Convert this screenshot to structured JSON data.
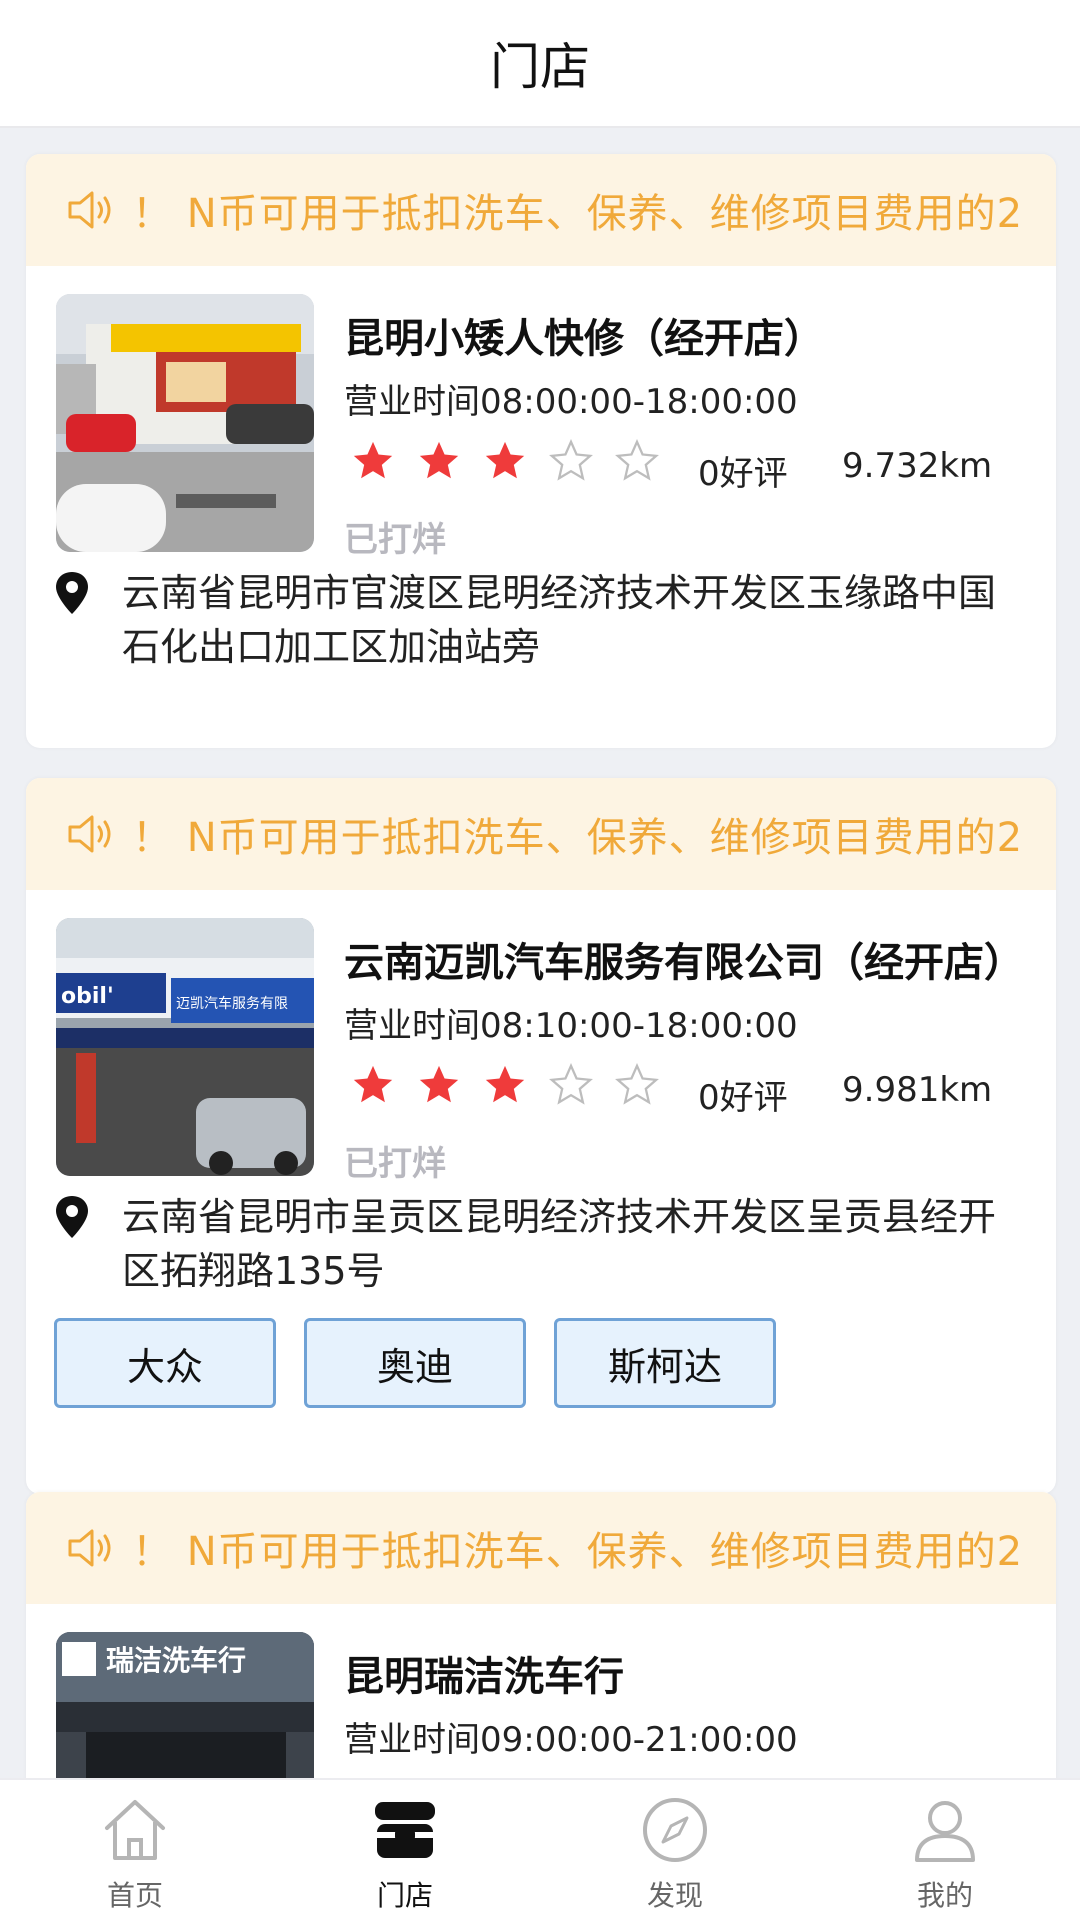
{
  "header": {
    "title": "门店"
  },
  "notice_text": "！ N币可用于抵扣洗车、保养、维修项目费用的2",
  "colors": {
    "accent_star": "#ef3b3b",
    "notice_text": "#f0a93a",
    "notice_bg": "#fdf4e3",
    "tag_bg": "#e6f2fd",
    "tag_border": "#6fa2d6"
  },
  "shops": [
    {
      "name": "昆明小矮人快修（经开店）",
      "hours": "营业时间08:00:00-18:00:00",
      "rating": 3,
      "rating_max": 5,
      "reviews": "0好评",
      "distance": "9.732km",
      "flag": "已打烊",
      "address": "云南省昆明市官渡区昆明经济技术开发区玉缘路中国石化出口加工区加油站旁",
      "tags": []
    },
    {
      "name": "云南迈凯汽车服务有限公司（经开店）",
      "hours": "营业时间08:10:00-18:00:00",
      "rating": 3,
      "rating_max": 5,
      "reviews": "0好评",
      "distance": "9.981km",
      "flag": "已打烊",
      "address": "云南省昆明市呈贡区昆明经济技术开发区呈贡县经开区拓翔路135号",
      "tags": [
        "大众",
        "奥迪",
        "斯柯达"
      ],
      "sign_text": "迈凯汽车服务有限"
    },
    {
      "name": "昆明瑞洁洗车行",
      "hours": "营业时间09:00:00-21:00:00",
      "sign_text": "瑞洁洗车行"
    }
  ],
  "tabbar": {
    "items": [
      {
        "label": "首页",
        "icon": "home-icon",
        "active": false
      },
      {
        "label": "门店",
        "icon": "store-icon",
        "active": true
      },
      {
        "label": "发现",
        "icon": "compass-icon",
        "active": false
      },
      {
        "label": "我的",
        "icon": "user-icon",
        "active": false
      }
    ]
  }
}
